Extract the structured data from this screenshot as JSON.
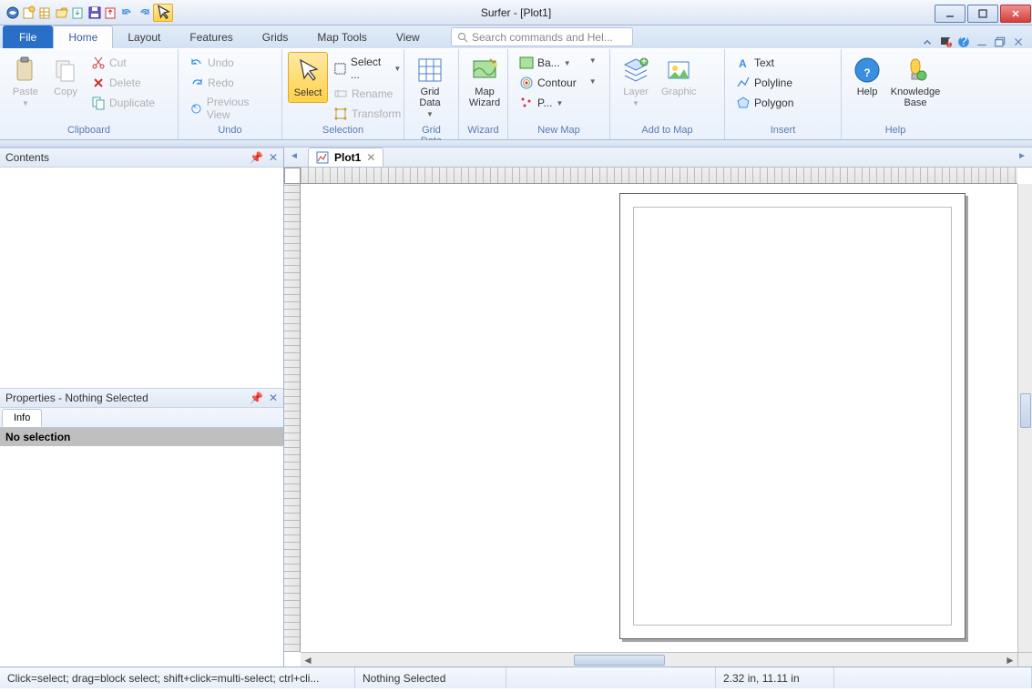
{
  "title": "Surfer - [Plot1]",
  "tabs": {
    "file": "File",
    "list": [
      "Home",
      "Layout",
      "Features",
      "Grids",
      "Map Tools",
      "View"
    ],
    "active": "Home"
  },
  "search_placeholder": "Search commands and Hel...",
  "ribbon": {
    "clipboard": {
      "label": "Clipboard",
      "paste": "Paste",
      "copy": "Copy",
      "cut": "Cut",
      "delete": "Delete",
      "duplicate": "Duplicate"
    },
    "undo": {
      "label": "Undo",
      "undo": "Undo",
      "redo": "Redo",
      "prev": "Previous View"
    },
    "selection": {
      "label": "Selection",
      "select": "Select",
      "selectall": "Select ...",
      "rename": "Rename",
      "transform": "Transform"
    },
    "griddata": {
      "label": "Grid Data",
      "button": "Grid\nData"
    },
    "wizard": {
      "label": "Wizard",
      "button": "Map\nWizard"
    },
    "newmap": {
      "label": "New Map",
      "base": "Ba...",
      "contour": "Contour",
      "post": "P..."
    },
    "addmap": {
      "label": "Add to Map",
      "layer": "Layer",
      "graphic": "Graphic"
    },
    "insert": {
      "label": "Insert",
      "text": "Text",
      "polyline": "Polyline",
      "polygon": "Polygon"
    },
    "help": {
      "label": "Help",
      "help": "Help",
      "kb": "Knowledge\nBase"
    }
  },
  "panels": {
    "contents_title": "Contents",
    "properties_title": "Properties - Nothing Selected",
    "info_tab": "Info",
    "no_selection": "No selection"
  },
  "doc": {
    "tab": "Plot1"
  },
  "status": {
    "hint": "Click=select; drag=block select; shift+click=multi-select; ctrl+cli...",
    "selection": "Nothing Selected",
    "coords": "2.32 in, 11.11 in"
  }
}
